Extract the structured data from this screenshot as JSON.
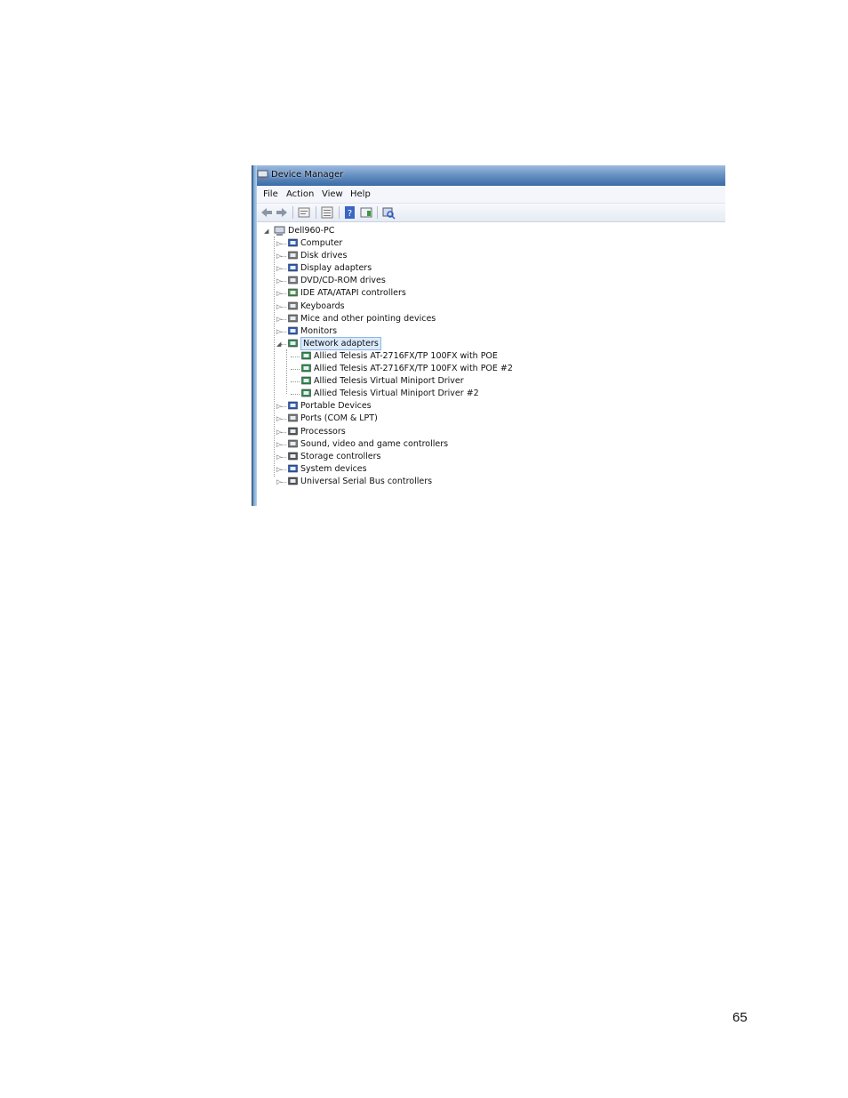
{
  "window": {
    "title": "Device Manager"
  },
  "menu": [
    "File",
    "Action",
    "View",
    "Help"
  ],
  "toolbar": {
    "buttons": [
      "back-icon",
      "forward-icon",
      "properties-icon",
      "show-hide-tree-icon",
      "help-icon",
      "update-driver-icon",
      "scan-hardware-icon"
    ]
  },
  "tree": {
    "root": "Dell960-PC",
    "categories": [
      {
        "label": "Computer",
        "icon": "computer-icon",
        "color": "#2a5bbf"
      },
      {
        "label": "Disk drives",
        "icon": "disk-drive-icon",
        "color": "#7a7a7a"
      },
      {
        "label": "Display adapters",
        "icon": "display-adapter-icon",
        "color": "#2a5bbf"
      },
      {
        "label": "DVD/CD-ROM drives",
        "icon": "dvd-drive-icon",
        "color": "#7a7a7a"
      },
      {
        "label": "IDE ATA/ATAPI controllers",
        "icon": "ide-controller-icon",
        "color": "#4a8f4a"
      },
      {
        "label": "Keyboards",
        "icon": "keyboard-icon",
        "color": "#7a7a7a"
      },
      {
        "label": "Mice and other pointing devices",
        "icon": "mouse-icon",
        "color": "#7a7a7a"
      },
      {
        "label": "Monitors",
        "icon": "monitor-icon",
        "color": "#2a5bbf"
      },
      {
        "label": "Network adapters",
        "icon": "network-adapter-icon",
        "color": "#2f8f4f",
        "expanded": true,
        "selected": true
      }
    ],
    "network_children": [
      "Allied Telesis AT-2716FX/TP 100FX with POE",
      "Allied Telesis AT-2716FX/TP 100FX with POE #2",
      "Allied Telesis Virtual Miniport Driver",
      "Allied Telesis Virtual Miniport Driver #2"
    ],
    "categories_after": [
      {
        "label": "Portable Devices",
        "icon": "portable-device-icon",
        "color": "#2a5bbf"
      },
      {
        "label": "Ports (COM & LPT)",
        "icon": "port-icon",
        "color": "#7a7a7a"
      },
      {
        "label": "Processors",
        "icon": "processor-icon",
        "color": "#555555"
      },
      {
        "label": "Sound, video and game controllers",
        "icon": "speaker-icon",
        "color": "#7a7a7a"
      },
      {
        "label": "Storage controllers",
        "icon": "storage-controller-icon",
        "color": "#555555"
      },
      {
        "label": "System devices",
        "icon": "system-device-icon",
        "color": "#2a5bbf"
      },
      {
        "label": "Universal Serial Bus controllers",
        "icon": "usb-icon",
        "color": "#555555"
      }
    ]
  },
  "page_number": "65"
}
